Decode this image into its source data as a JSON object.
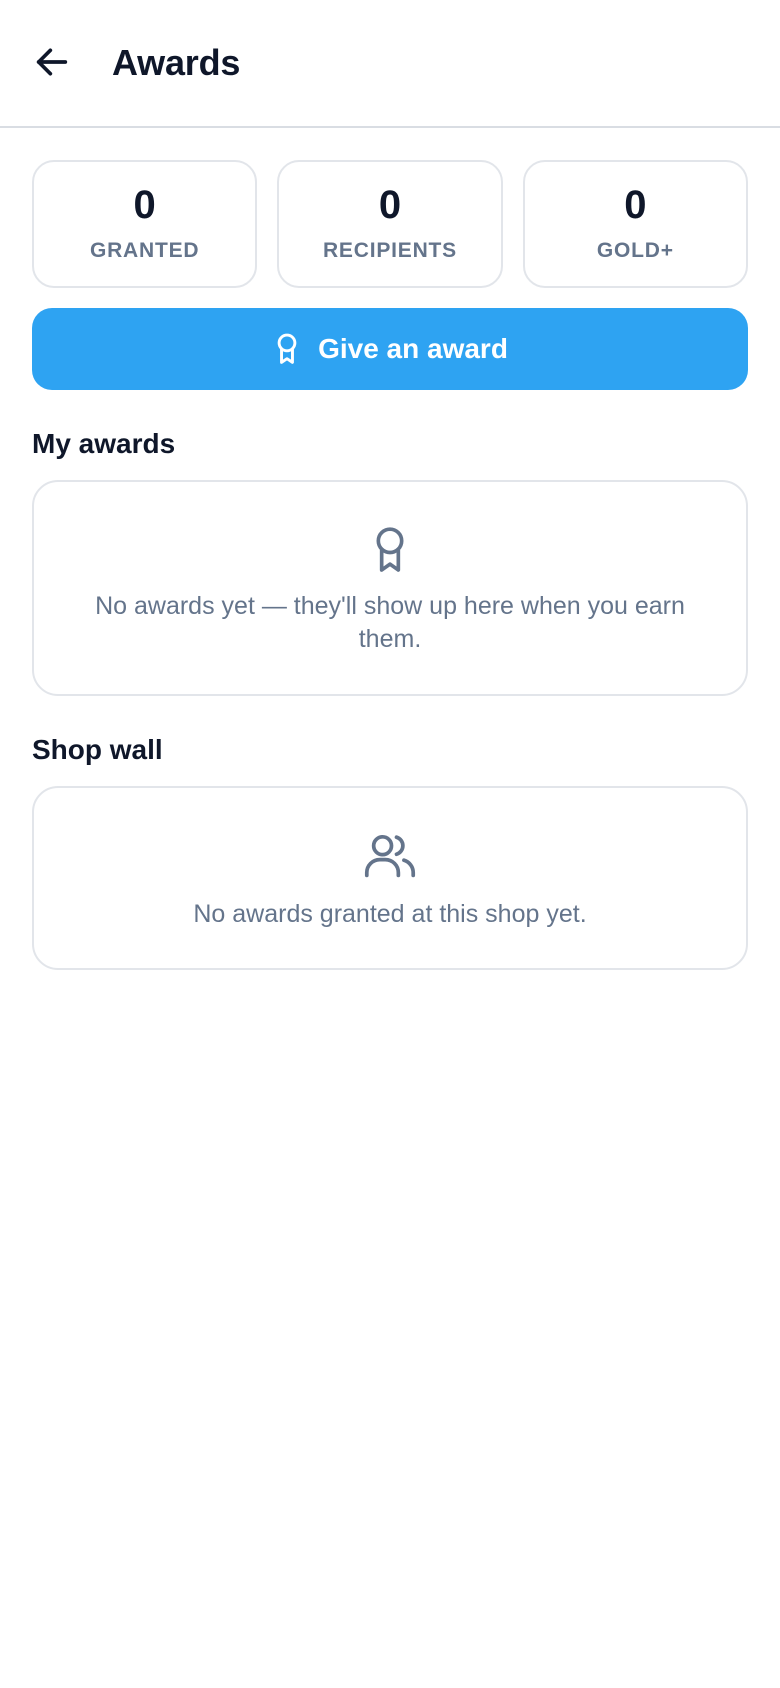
{
  "header": {
    "back_icon": "arrow-left-icon",
    "title": "Awards"
  },
  "stats": [
    {
      "value": "0",
      "label": "GRANTED"
    },
    {
      "value": "0",
      "label": "RECIPIENTS"
    },
    {
      "value": "0",
      "label": "GOLD+"
    }
  ],
  "give_award": {
    "icon": "award-ribbon-icon",
    "label": "Give an award",
    "color": "#2ea3f2"
  },
  "my_awards": {
    "title": "My awards",
    "icon": "award-ribbon-icon",
    "empty_text": "No awards yet — they'll show up here when you earn them."
  },
  "shop_wall": {
    "title": "Shop wall",
    "icon": "users-icon",
    "empty_text": "No awards granted at this shop yet."
  }
}
